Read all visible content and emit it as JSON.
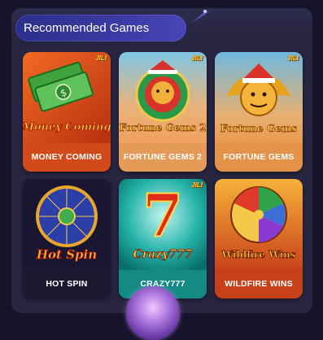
{
  "section": {
    "title": "Recommended Games"
  },
  "games": [
    {
      "name": "MONEY COMING",
      "logo": "Money Coming",
      "provider": "JILI"
    },
    {
      "name": "FORTUNE GEMS 2",
      "logo": "Fortune Gems 2",
      "provider": "JILI"
    },
    {
      "name": "FORTUNE GEMS",
      "logo": "Fortune Gems",
      "provider": "JILI"
    },
    {
      "name": "HOT SPIN",
      "logo": "Hot Spin",
      "provider": ""
    },
    {
      "name": "CRAZY777",
      "logo": "Crazy777",
      "provider": "JILI"
    },
    {
      "name": "WILDFIRE WINS",
      "logo": "Wildfire Wins",
      "provider": ""
    }
  ],
  "colors": {
    "panel": "#27253f",
    "pill": "#3c3aa3",
    "card_money": "#e0521d",
    "card_fortune2": "#f0a060",
    "card_fortune": "#e89a50",
    "card_hotspin": "#1d1730",
    "card_crazy": "#0f8f8a",
    "card_wildfire": "#c9421a"
  },
  "icons": {
    "fab": "gem-icon"
  }
}
